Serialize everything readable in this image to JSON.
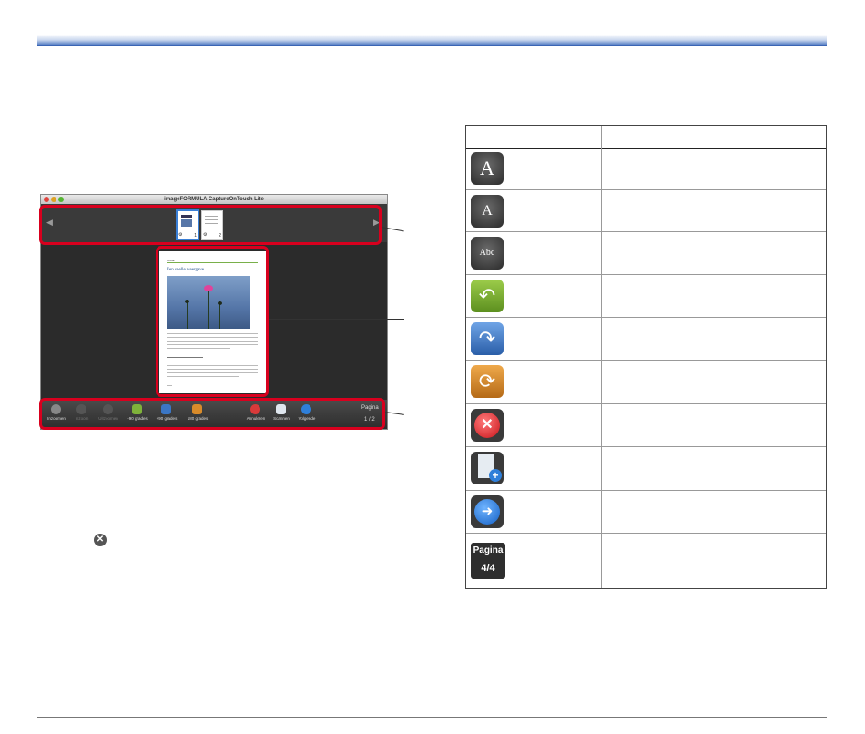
{
  "window": {
    "title": "imageFORMULA CaptureOnTouch Lite"
  },
  "thumbnails": [
    {
      "number": "1"
    },
    {
      "number": "2"
    }
  ],
  "document_preview": {
    "header": "Grüße",
    "title": "Een snelle weergave"
  },
  "toolbar": {
    "buttons": [
      {
        "label": "Inzoomen",
        "enabled": true
      },
      {
        "label": "Inzoom",
        "enabled": false
      },
      {
        "label": "Uitzoomen",
        "enabled": false
      },
      {
        "label": "-90 grades",
        "enabled": true
      },
      {
        "label": "+90 grades",
        "enabled": true
      },
      {
        "label": "180 grades",
        "enabled": true
      },
      {
        "label": "Annuleren",
        "enabled": true
      },
      {
        "label": "Scannen",
        "enabled": true
      },
      {
        "label": "Volgende",
        "enabled": true
      }
    ],
    "pager_label": "Pagina",
    "pager_count": "1 / 2"
  },
  "icon_table": {
    "rows": [
      {
        "icon": "zoom-in-icon",
        "glyph": "A"
      },
      {
        "icon": "zoom-out-icon",
        "glyph": "A"
      },
      {
        "icon": "fit-page-icon",
        "glyph": "Abc"
      },
      {
        "icon": "rotate-left-icon",
        "glyph": "↶"
      },
      {
        "icon": "rotate-right-icon",
        "glyph": "↷"
      },
      {
        "icon": "rotate-180-icon",
        "glyph": "⟳"
      },
      {
        "icon": "cancel-icon",
        "glyph": "✕"
      },
      {
        "icon": "scan-more-icon",
        "glyph": "+"
      },
      {
        "icon": "next-icon",
        "glyph": "➜"
      },
      {
        "icon": "page-counter-icon",
        "glyph": "Pagina",
        "glyph2": "4/4"
      }
    ]
  },
  "colors": {
    "accent": "#3a65b4",
    "callout": "#d8001e"
  }
}
